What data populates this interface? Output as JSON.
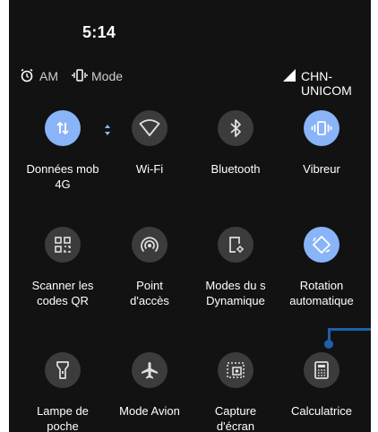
{
  "status_bar": {
    "time": "5:14",
    "alarm_label": "AM",
    "mode_label": "Mode",
    "carrier": "CHN-UNICOM"
  },
  "tiles": [
    {
      "label": "Données mob\n4G",
      "icon": "mobile-data-icon",
      "active": true
    },
    {
      "label": "Wi-Fi",
      "icon": "wifi-icon",
      "active": false
    },
    {
      "label": "Bluetooth",
      "icon": "bluetooth-icon",
      "active": false
    },
    {
      "label": "Vibreur",
      "icon": "vibrate-icon",
      "active": true
    },
    {
      "label": "Scanner les\ncodes QR",
      "icon": "qr-code-icon",
      "active": false
    },
    {
      "label": "Point\nd'accès",
      "icon": "hotspot-icon",
      "active": false
    },
    {
      "label": "Modes du s\nDynamique",
      "icon": "system-mode-icon",
      "active": false
    },
    {
      "label": "Rotation\nautomatique",
      "icon": "auto-rotate-icon",
      "active": true
    },
    {
      "label": "Lampe de\npoche",
      "icon": "flashlight-icon",
      "active": false
    },
    {
      "label": "Mode Avion",
      "icon": "airplane-icon",
      "active": false
    },
    {
      "label": "Capture\nd'écran",
      "icon": "screenshot-icon",
      "active": false
    },
    {
      "label": "Calculatrice",
      "icon": "calculator-icon",
      "active": false
    }
  ],
  "colors": {
    "background": "#121212",
    "tile_off": "#3c3c3c",
    "tile_on": "#8ab4f8",
    "annotation": "#1f5fa8"
  }
}
